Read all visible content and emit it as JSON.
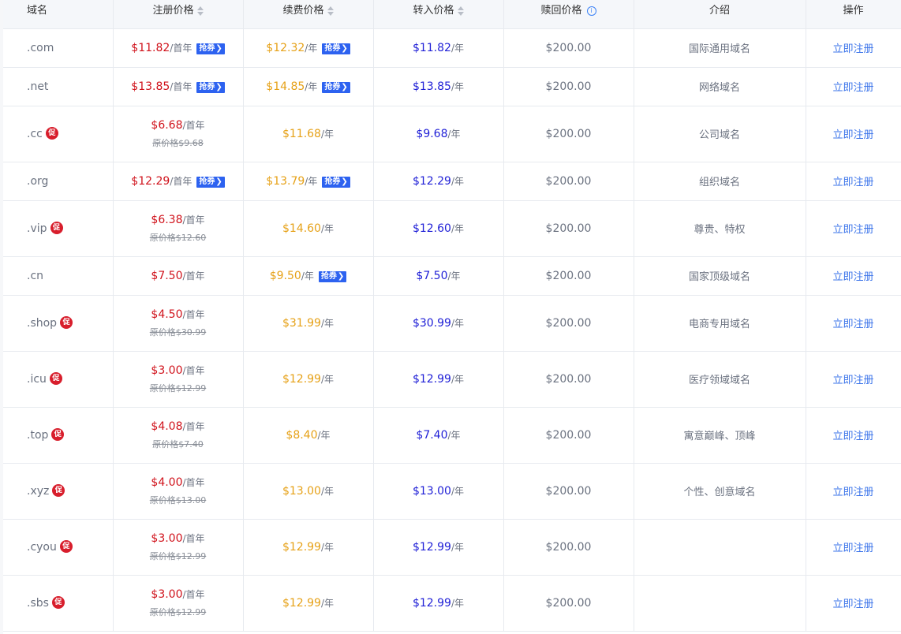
{
  "headers": {
    "domain": "域名",
    "register": "注册价格",
    "renew": "续费价格",
    "transfer": "转入价格",
    "redeem": "赎回价格",
    "intro": "介绍",
    "action": "操作"
  },
  "icons": {
    "sort": "sort-icon",
    "info": "info-icon",
    "promo": "promo-badge-icon"
  },
  "labels": {
    "per_first_year": "/首年",
    "per_year": "/年",
    "coupon": "抢券",
    "original_prefix": "原价格",
    "register_now": "立即注册",
    "promo_char": "促",
    "info_char": "i"
  },
  "colors": {
    "register_price": "#d0121b",
    "renew_price": "#e6a117",
    "transfer_price": "#1d1dd6",
    "link": "#3a73ea",
    "coupon_bg": "#2d62f0",
    "promo_bg": "#d81e2c"
  },
  "rows": [
    {
      "name": ".com",
      "promo": false,
      "reg": "$11.82",
      "reg_coupon": true,
      "orig": "",
      "renew": "$12.32",
      "renew_coupon": true,
      "transfer": "$11.82",
      "redeem": "$200.00",
      "intro": "国际通用域名"
    },
    {
      "name": ".net",
      "promo": false,
      "reg": "$13.85",
      "reg_coupon": true,
      "orig": "",
      "renew": "$14.85",
      "renew_coupon": true,
      "transfer": "$13.85",
      "redeem": "$200.00",
      "intro": "网络域名"
    },
    {
      "name": ".cc",
      "promo": true,
      "reg": "$6.68",
      "reg_coupon": false,
      "orig": "$9.68",
      "renew": "$11.68",
      "renew_coupon": false,
      "transfer": "$9.68",
      "redeem": "$200.00",
      "intro": "公司域名"
    },
    {
      "name": ".org",
      "promo": false,
      "reg": "$12.29",
      "reg_coupon": true,
      "orig": "",
      "renew": "$13.79",
      "renew_coupon": true,
      "transfer": "$12.29",
      "redeem": "$200.00",
      "intro": "组织域名"
    },
    {
      "name": ".vip",
      "promo": true,
      "reg": "$6.38",
      "reg_coupon": false,
      "orig": "$12.60",
      "renew": "$14.60",
      "renew_coupon": false,
      "transfer": "$12.60",
      "redeem": "$200.00",
      "intro": "尊贵、特权"
    },
    {
      "name": ".cn",
      "promo": false,
      "reg": "$7.50",
      "reg_coupon": false,
      "orig": "",
      "renew": "$9.50",
      "renew_coupon": true,
      "transfer": "$7.50",
      "redeem": "$200.00",
      "intro": "国家顶级域名"
    },
    {
      "name": ".shop",
      "promo": true,
      "reg": "$4.50",
      "reg_coupon": false,
      "orig": "$30.99",
      "renew": "$31.99",
      "renew_coupon": false,
      "transfer": "$30.99",
      "redeem": "$200.00",
      "intro": "电商专用域名"
    },
    {
      "name": ".icu",
      "promo": true,
      "reg": "$3.00",
      "reg_coupon": false,
      "orig": "$12.99",
      "renew": "$12.99",
      "renew_coupon": false,
      "transfer": "$12.99",
      "redeem": "$200.00",
      "intro": "医疗领域域名"
    },
    {
      "name": ".top",
      "promo": true,
      "reg": "$4.08",
      "reg_coupon": false,
      "orig": "$7.40",
      "renew": "$8.40",
      "renew_coupon": false,
      "transfer": "$7.40",
      "redeem": "$200.00",
      "intro": "寓意巅峰、顶峰"
    },
    {
      "name": ".xyz",
      "promo": true,
      "reg": "$4.00",
      "reg_coupon": false,
      "orig": "$13.00",
      "renew": "$13.00",
      "renew_coupon": false,
      "transfer": "$13.00",
      "redeem": "$200.00",
      "intro": "个性、创意域名"
    },
    {
      "name": ".cyou",
      "promo": true,
      "reg": "$3.00",
      "reg_coupon": false,
      "orig": "$12.99",
      "renew": "$12.99",
      "renew_coupon": false,
      "transfer": "$12.99",
      "redeem": "$200.00",
      "intro": ""
    },
    {
      "name": ".sbs",
      "promo": true,
      "reg": "$3.00",
      "reg_coupon": false,
      "orig": "$12.99",
      "renew": "$12.99",
      "renew_coupon": false,
      "transfer": "$12.99",
      "redeem": "$200.00",
      "intro": ""
    }
  ]
}
